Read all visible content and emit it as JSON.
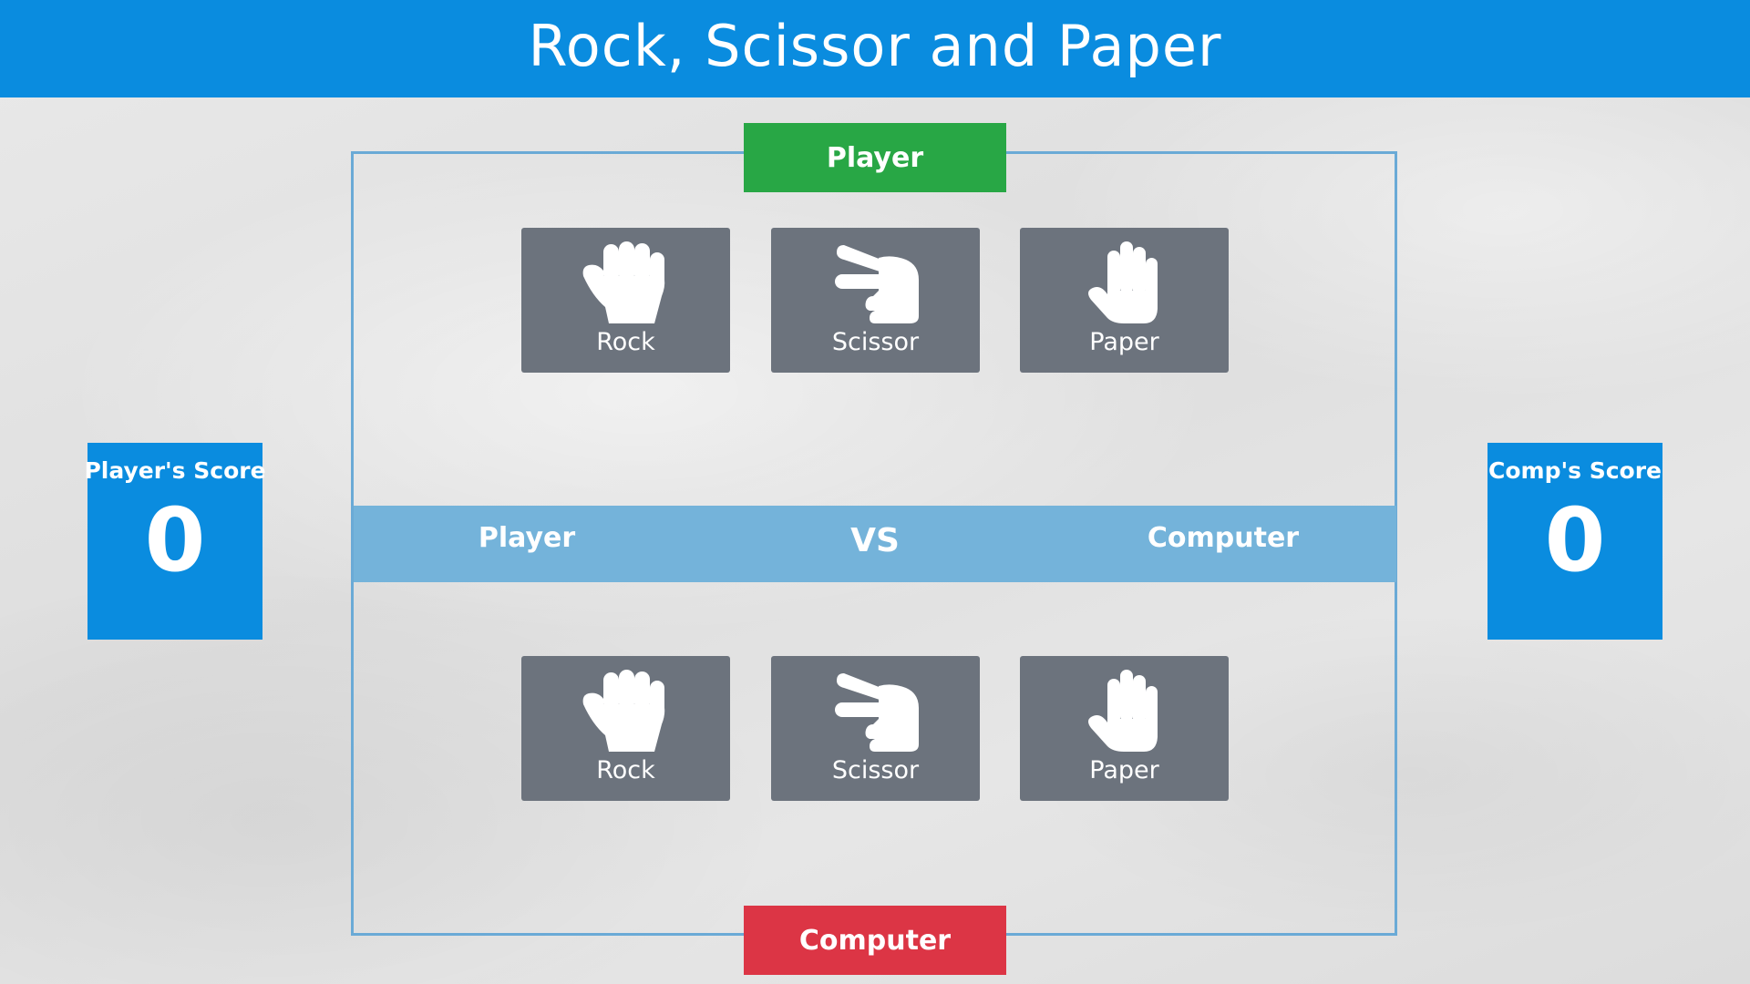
{
  "header": {
    "title": "Rock, Scissor and Paper"
  },
  "player_section": {
    "label": "Player",
    "choices": [
      {
        "label": "Rock",
        "icon": "rock-hand-icon"
      },
      {
        "label": "Scissor",
        "icon": "scissor-hand-icon"
      },
      {
        "label": "Paper",
        "icon": "paper-hand-icon"
      }
    ]
  },
  "computer_section": {
    "label": "Computer",
    "choices": [
      {
        "label": "Rock",
        "icon": "rock-hand-icon"
      },
      {
        "label": "Scissor",
        "icon": "scissor-hand-icon"
      },
      {
        "label": "Paper",
        "icon": "paper-hand-icon"
      }
    ]
  },
  "versus": {
    "left": "Player",
    "middle": "VS",
    "right": "Computer"
  },
  "scores": {
    "player": {
      "title": "Player's Score",
      "value": "0"
    },
    "computer": {
      "title": "Comp's Score",
      "value": "0"
    }
  },
  "colors": {
    "header": "#0a8cdf",
    "player_label": "#28a745",
    "computer_label": "#dc3545",
    "choice_card": "#6c737d",
    "vs_bar": "#74b3da",
    "score_box": "#0a8cdf"
  }
}
